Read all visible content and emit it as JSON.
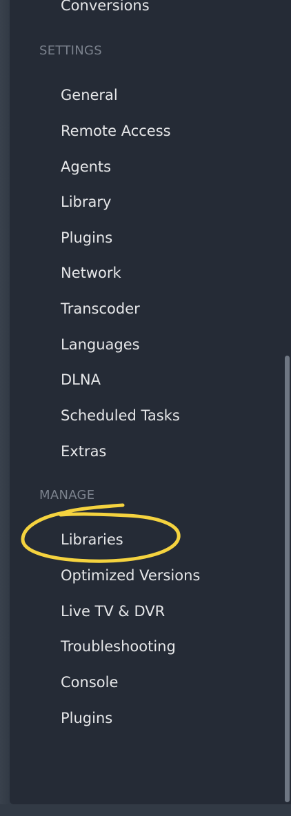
{
  "sidebar": {
    "partial_item": {
      "label": "Conversions"
    },
    "settings": {
      "header": "SETTINGS",
      "items": [
        {
          "label": "General"
        },
        {
          "label": "Remote Access"
        },
        {
          "label": "Agents"
        },
        {
          "label": "Library"
        },
        {
          "label": "Plugins"
        },
        {
          "label": "Network"
        },
        {
          "label": "Transcoder"
        },
        {
          "label": "Languages"
        },
        {
          "label": "DLNA"
        },
        {
          "label": "Scheduled Tasks"
        },
        {
          "label": "Extras"
        }
      ]
    },
    "manage": {
      "header": "MANAGE",
      "items": [
        {
          "label": "Libraries"
        },
        {
          "label": "Optimized Versions"
        },
        {
          "label": "Live TV & DVR"
        },
        {
          "label": "Troubleshooting"
        },
        {
          "label": "Console"
        },
        {
          "label": "Plugins"
        }
      ]
    }
  },
  "annotation": {
    "shape": "hand-drawn ellipse",
    "color": "#f5d33f",
    "target": "Libraries"
  },
  "colors": {
    "sidebar_bg": "#252b36",
    "item_text": "#e6e7e9",
    "header_text": "#7b828d",
    "scrollbar": "#6f7783"
  }
}
